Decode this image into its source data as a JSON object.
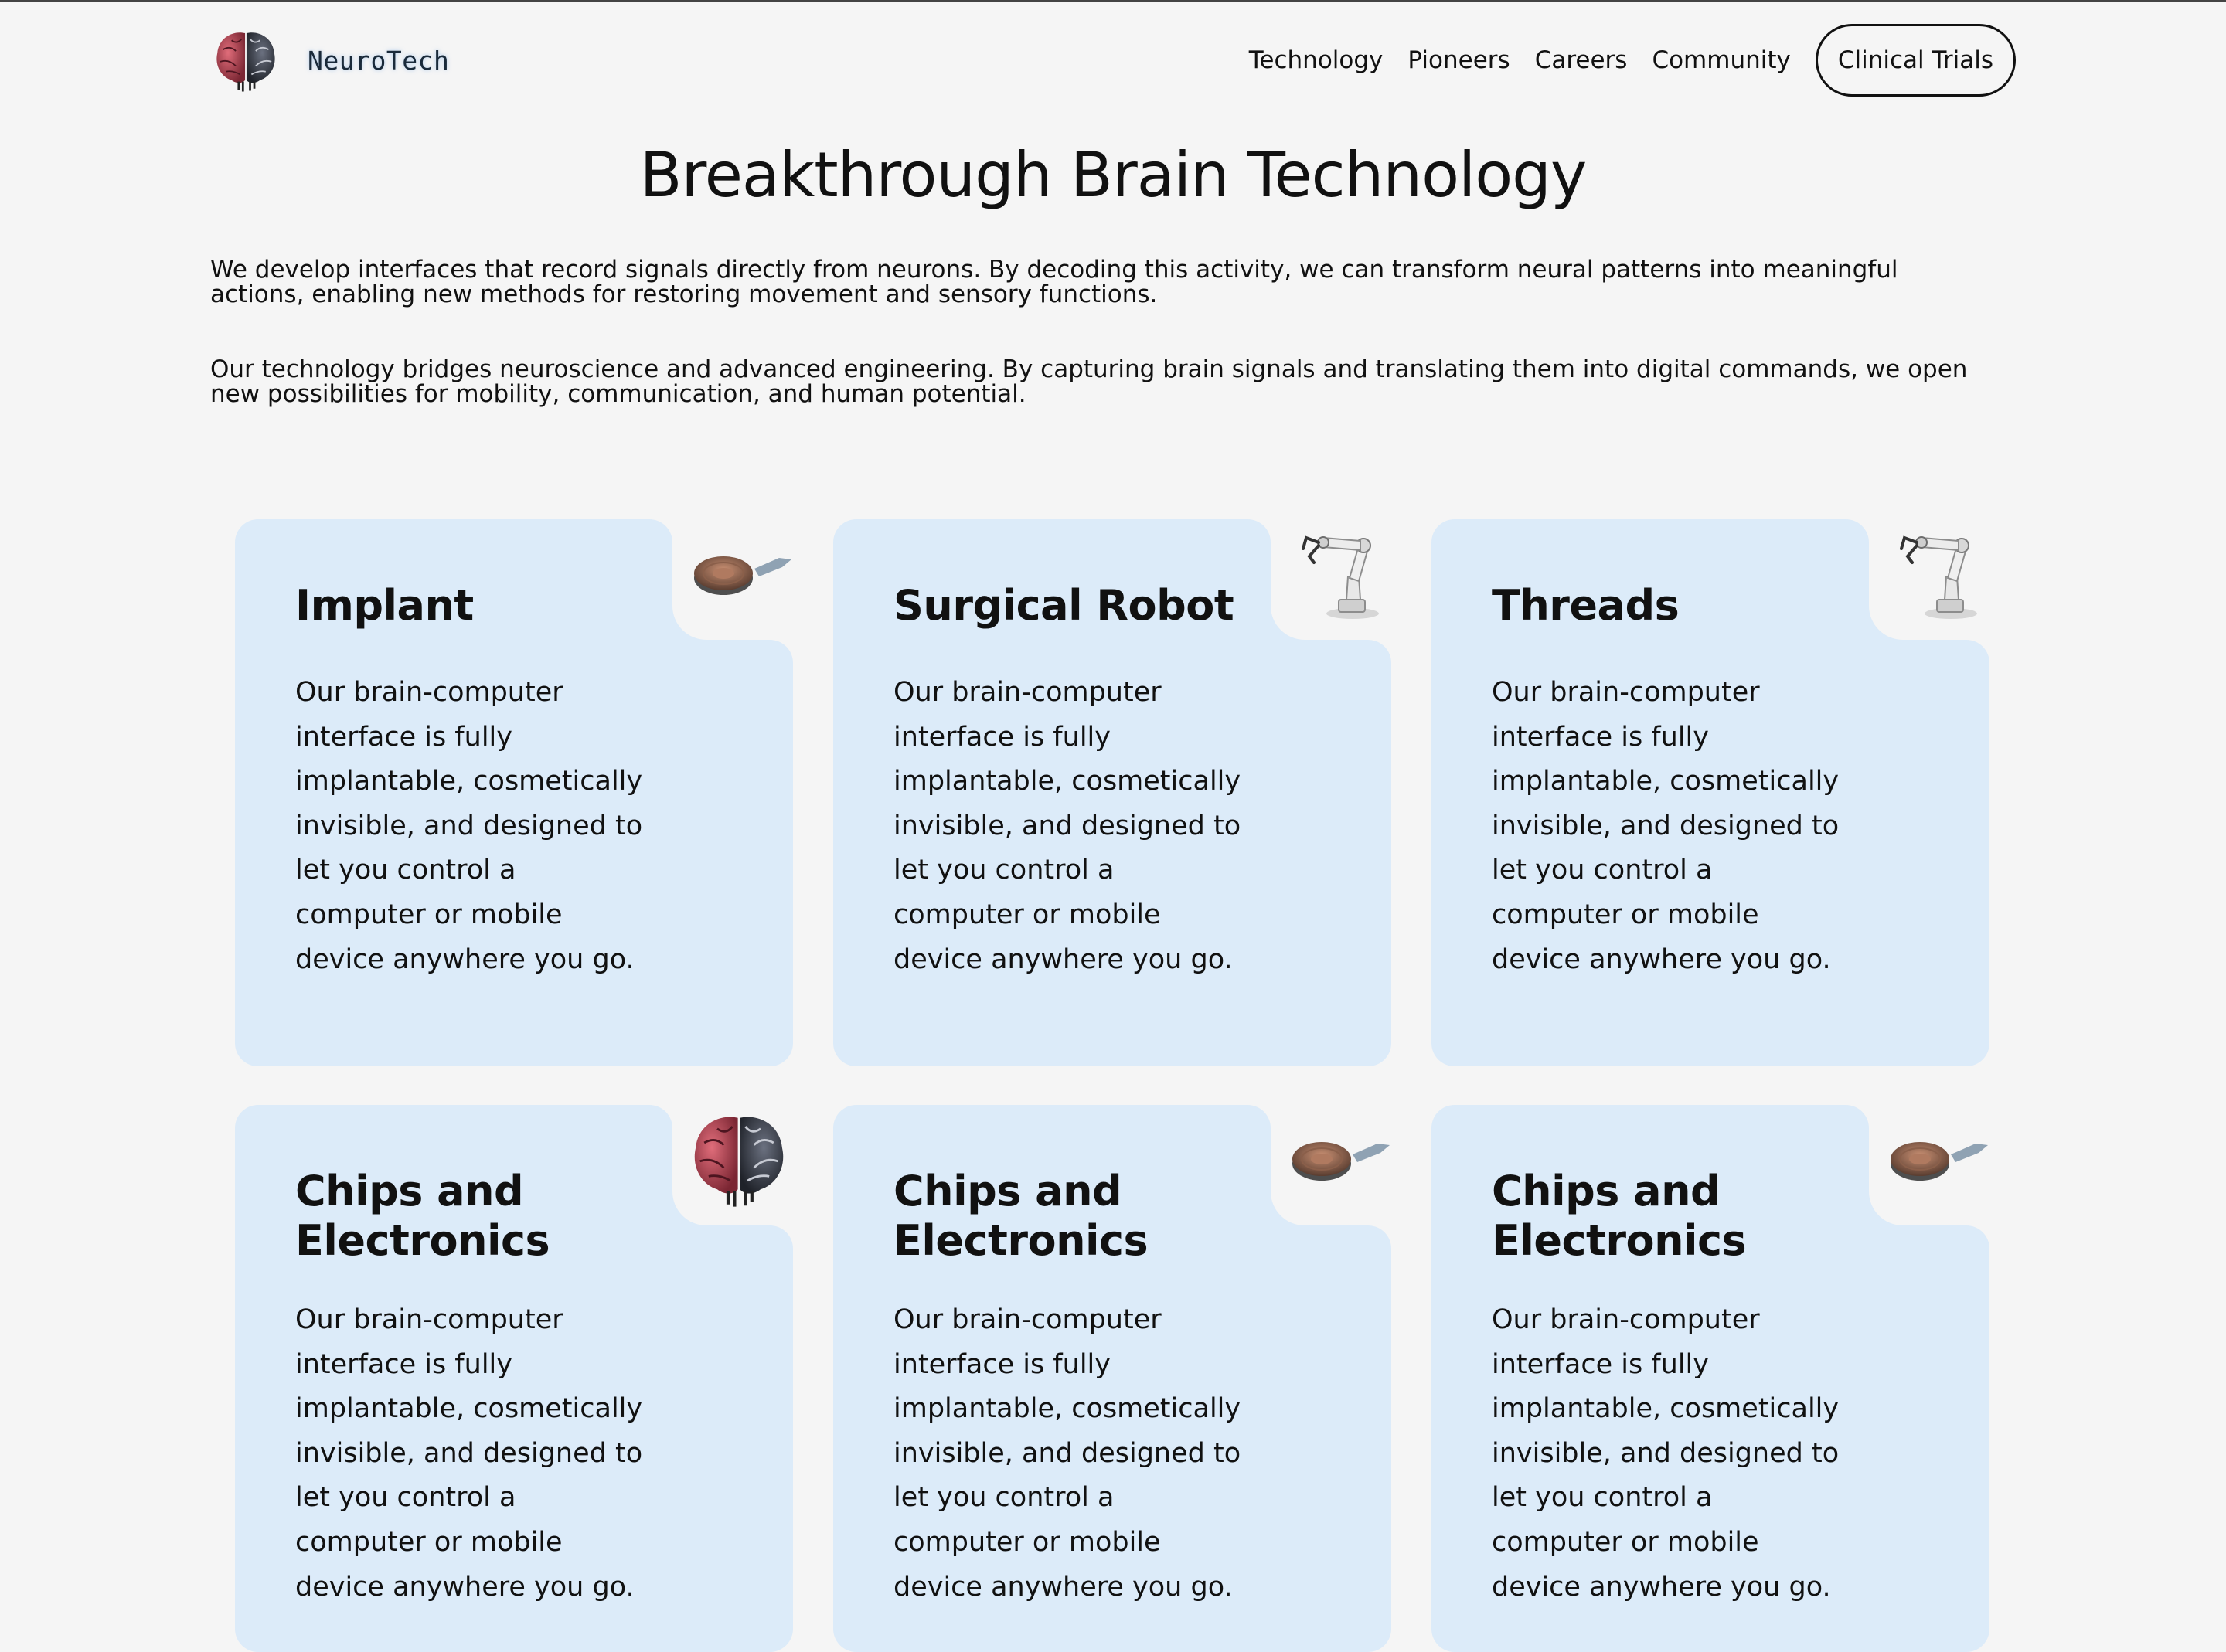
{
  "brand": {
    "name": "NeuroTech",
    "logo_icon": "brain-icon"
  },
  "nav": {
    "links": [
      "Technology",
      "Pioneers",
      "Careers",
      "Community"
    ],
    "cta": "Clinical Trials"
  },
  "hero": {
    "title": "Breakthrough Brain Technology",
    "paragraphs": [
      "We develop interfaces that record signals directly from neurons. By decoding this activity, we can transform neural patterns into meaningful actions, enabling new methods for restoring movement and sensory functions.",
      "Our technology bridges neuroscience and advanced engineering. By capturing brain signals and translating them into digital commands, we open new possibilities for mobility, communication, and human potential."
    ]
  },
  "cards": [
    {
      "title": "Implant",
      "body": "Our brain-computer interface is fully implantable, cosmetically invisible, and designed to let you control a computer or mobile device anywhere you go.",
      "icon": "implant-icon"
    },
    {
      "title": "Surgical Robot",
      "body": "Our brain-computer interface is fully implantable, cosmetically invisible, and designed to let you control a computer or mobile device anywhere you go.",
      "icon": "robot-arm-icon"
    },
    {
      "title": "Threads",
      "body": "Our brain-computer interface is fully implantable, cosmetically invisible, and designed to let you control a computer or mobile device anywhere you go.",
      "icon": "robot-arm-icon"
    },
    {
      "title": "Chips and Electronics",
      "body": "Our brain-computer interface is fully implantable, cosmetically invisible, and designed to let you control a computer or mobile device anywhere you go.",
      "icon": "brain-icon"
    },
    {
      "title": "Chips and Electronics",
      "body": "Our brain-computer interface is fully implantable, cosmetically invisible, and designed to let you control a computer or mobile device anywhere you go.",
      "icon": "implant-icon"
    },
    {
      "title": "Chips and Electronics",
      "body": "Our brain-computer interface is fully implantable, cosmetically invisible, and designed to let you control a computer or mobile device anywhere you go.",
      "icon": "implant-icon"
    }
  ],
  "colors": {
    "card_bg": "#dcebf9",
    "page_bg": "#f5f5f5",
    "text": "#111111"
  }
}
